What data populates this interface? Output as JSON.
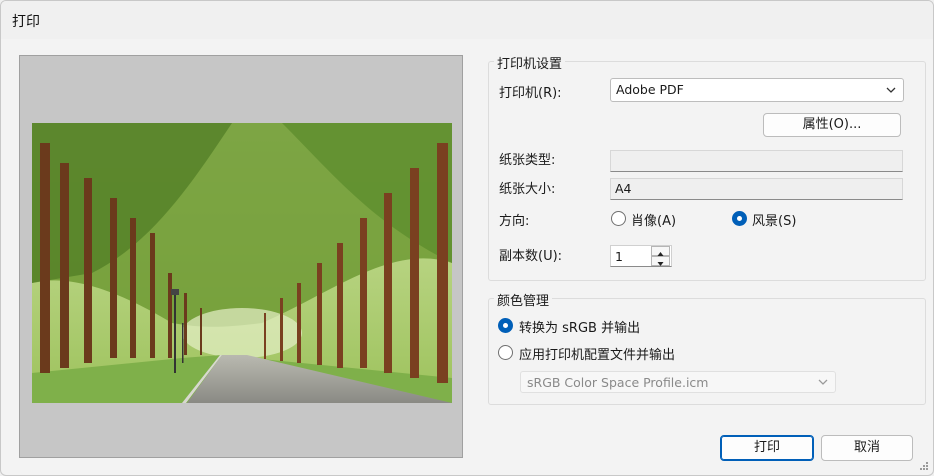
{
  "window": {
    "title": "打印"
  },
  "printer_settings": {
    "group_title": "打印机设置",
    "printer_label": "打印机(R):",
    "printer_value": "Adobe PDF",
    "properties_button": "属性(O)...",
    "paper_type_label": "纸张类型:",
    "paper_type_value": "",
    "paper_size_label": "纸张大小:",
    "paper_size_value": "A4",
    "orientation_label": "方向:",
    "orientation_options": [
      {
        "label": "肖像(A)",
        "selected": false
      },
      {
        "label": "风景(S)",
        "selected": true
      }
    ],
    "copies_label": "副本数(U):",
    "copies_value": "1"
  },
  "color_management": {
    "group_title": "颜色管理",
    "options": [
      {
        "label": "转换为 sRGB 并输出",
        "selected": true
      },
      {
        "label": "应用打印机配置文件并输出",
        "selected": false
      }
    ],
    "profile_value": "sRGB Color Space Profile.icm"
  },
  "buttons": {
    "print": "打印",
    "cancel": "取消"
  },
  "colors": {
    "accent": "#005fb8",
    "preview_bg": "#c6c6c6"
  }
}
